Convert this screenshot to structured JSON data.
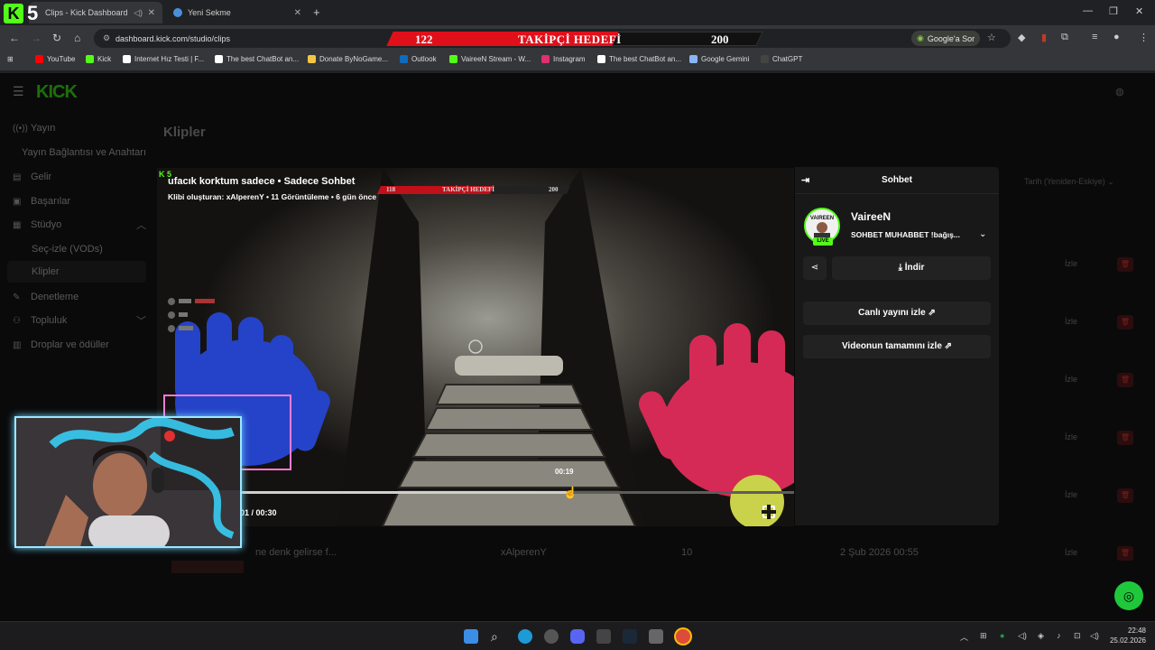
{
  "browser": {
    "tabs": [
      {
        "label": "Clips - Kick Dashboard",
        "active": true
      },
      {
        "label": "Yeni Sekme",
        "active": false
      }
    ],
    "url": "dashboard.kick.com/studio/clips",
    "google_ask": "Google'a Sor",
    "bookmarks": [
      {
        "label": "YouTube",
        "color": "#ff0000"
      },
      {
        "label": "Kick",
        "color": "#53fc18"
      },
      {
        "label": "Internet Hız Testi | F...",
        "color": "#ffffff"
      },
      {
        "label": "The best ChatBot an...",
        "color": "#ffffff"
      },
      {
        "label": "Donate ByNoGame...",
        "color": "#f4c542"
      },
      {
        "label": "Outlook",
        "color": "#0f6cbd"
      },
      {
        "label": "VaireeN Stream - W...",
        "color": "#53fc18"
      },
      {
        "label": "Instagram",
        "color": "#e1306c"
      },
      {
        "label": "The best ChatBot an...",
        "color": "#ffffff"
      },
      {
        "label": "Google Gemini",
        "color": "#8ab4f8"
      },
      {
        "label": "ChatGPT",
        "color": "#222222"
      }
    ]
  },
  "overlay": {
    "badge_letter": "K",
    "badge_number": "5",
    "follow_goal": {
      "current": "122",
      "label": "TAKİPÇİ HEDEFİ",
      "target": "200",
      "progress": 0.61
    }
  },
  "sidebar": {
    "logo": "KICK",
    "items": [
      {
        "label": "Yayın",
        "icon": "broadcast-icon"
      },
      {
        "label": "Yayın Bağlantısı ve Anahtarı",
        "icon": ""
      },
      {
        "label": "Gelir",
        "icon": "revenue-icon"
      },
      {
        "label": "Başarılar",
        "icon": "achievements-icon"
      },
      {
        "label": "Stüdyo",
        "icon": "studio-icon"
      },
      {
        "label": "Seç-izle (VODs)",
        "icon": ""
      },
      {
        "label": "Klipler",
        "icon": ""
      },
      {
        "label": "Denetleme",
        "icon": "moderation-icon"
      },
      {
        "label": "Topluluk",
        "icon": "community-icon"
      },
      {
        "label": "Droplar ve ödüller",
        "icon": "drops-icon"
      }
    ]
  },
  "main": {
    "title": "Klipler",
    "sort_label": "Tarih (Yeniden-Eskiye)",
    "row_action": "İzle",
    "visible_row": {
      "title": "ne denk gelirse f...",
      "creator": "xAlperenY",
      "views": "10",
      "date": "2 Şub 2026 00:55"
    }
  },
  "clip": {
    "title": "ufacık korktum sadece • Sadece Sohbet",
    "meta": "Klibi oluşturan: xAlperenY • 11 Görüntüleme • 6 gün önce",
    "inner_goal": {
      "current": "118",
      "label": "TAKİPÇİ HEDEFİ",
      "target": "200"
    },
    "hover_time": "00:19",
    "time_display": "01 / 00:30",
    "progress": 0.59
  },
  "chat": {
    "header": "Sohbet",
    "channel_name": "VaireeN",
    "avatar_text": "VAIREEN",
    "live_label": "LIVE",
    "stream_title": "SOHBET MUHABBET  !bağış...",
    "download_label": "İndir",
    "watch_live_label": "Canlı yayını izle",
    "watch_full_label": "Videonun tamamını izle"
  },
  "taskbar": {
    "time": "22:48",
    "date": "25.02.2026"
  }
}
